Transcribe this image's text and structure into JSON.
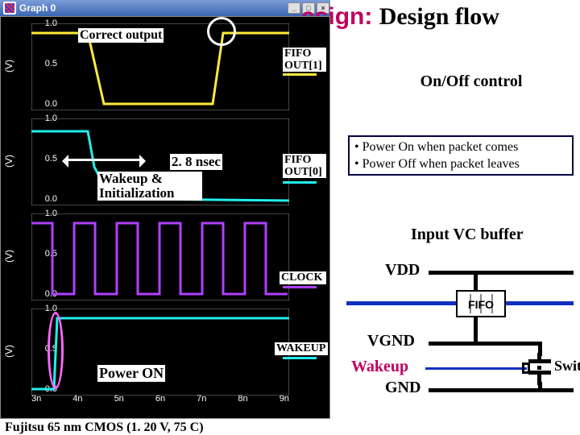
{
  "window": {
    "title": "Graph 0"
  },
  "header": {
    "suffix": "esign:",
    "subtitle": "Design flow"
  },
  "signals": {
    "s1": "FIFO OUT[1]",
    "s2": "FIFO OUT[0]",
    "s3": "CLOCK",
    "s4": "WAKEUP"
  },
  "annot": {
    "correct": "Correct output",
    "wake_time": "2. 8 nsec",
    "wake_init": "Wakeup & Initialization",
    "power_on": "Power ON"
  },
  "axis": {
    "ylabel": "(V)",
    "y_hi": "1.0",
    "y_mid": "0.5",
    "y_lo": "0.0",
    "x": [
      "3n",
      "4n",
      "5n",
      "6n",
      "7n",
      "8n",
      "9n"
    ]
  },
  "caption": "Fujitsu 65 nm CMOS (1. 20 V, 75 C)",
  "onoff": {
    "title": "On/Off control",
    "line1": "• Power On when packet comes",
    "line2": "• Power Off when packet leaves"
  },
  "vc_title": "Input VC buffer",
  "diagram": {
    "vdd": "VDD",
    "fifo": "FIFO",
    "vgnd": "VGND",
    "wakeup": "Wakeup",
    "gnd": "GND",
    "switch": "Switch"
  },
  "chart_data": [
    {
      "name": "FIFO OUT[1]",
      "type": "line",
      "ylim": [
        0,
        1.2
      ],
      "xlim_ns": [
        3,
        9
      ],
      "points": [
        [
          3,
          1.05
        ],
        [
          4.2,
          1.05
        ],
        [
          4.6,
          0.05
        ],
        [
          7.3,
          0.05
        ],
        [
          7.6,
          1.05
        ],
        [
          9,
          1.05
        ]
      ]
    },
    {
      "name": "FIFO OUT[0]",
      "type": "line",
      "ylim": [
        0,
        1.2
      ],
      "xlim_ns": [
        3,
        9
      ],
      "points": [
        [
          3,
          1.0
        ],
        [
          4.2,
          1.0
        ],
        [
          4.8,
          0.1
        ],
        [
          9,
          0.05
        ]
      ]
    },
    {
      "name": "CLOCK",
      "type": "square",
      "ylim": [
        0,
        1.2
      ],
      "xlim_ns": [
        3,
        9
      ],
      "period_ns": 1.0,
      "high": 1.05,
      "low": 0.0,
      "duty": 0.5
    },
    {
      "name": "WAKEUP",
      "type": "step",
      "ylim": [
        0,
        1.2
      ],
      "xlim_ns": [
        3,
        9
      ],
      "points": [
        [
          3,
          0.0
        ],
        [
          3.5,
          0.0
        ],
        [
          3.55,
          1.05
        ],
        [
          9,
          1.05
        ]
      ]
    }
  ]
}
